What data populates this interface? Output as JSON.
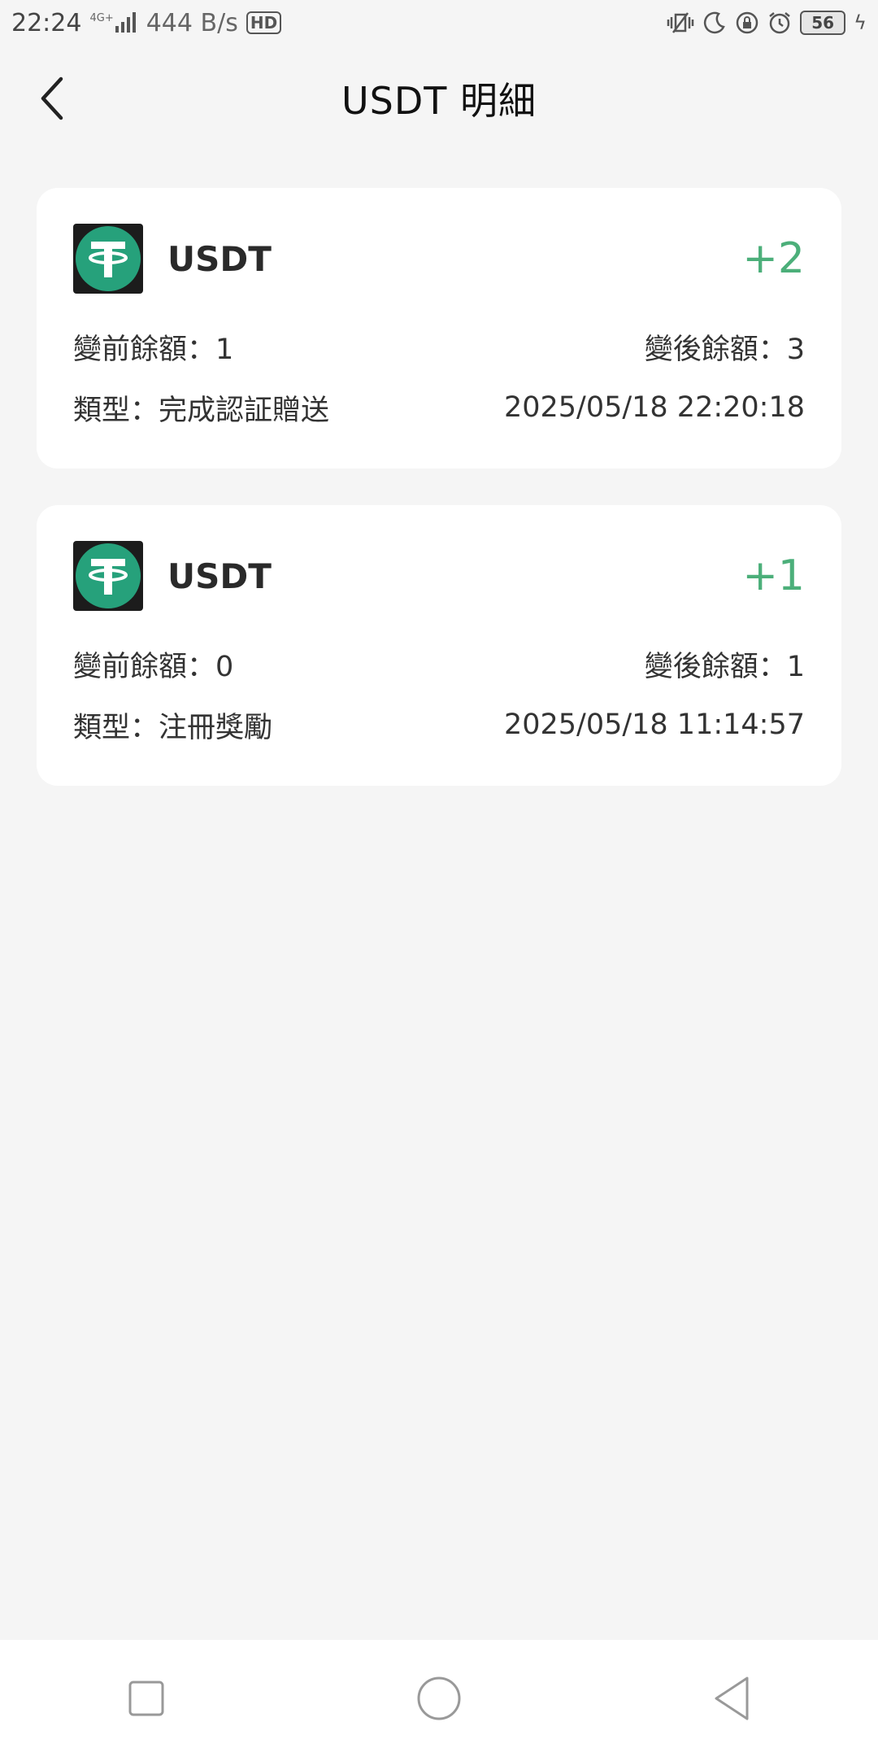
{
  "status_bar": {
    "time": "22:24",
    "network": "4G+",
    "speed": "444 B/s",
    "hd": "HD",
    "battery": "56"
  },
  "header": {
    "title": "USDT 明細"
  },
  "records": [
    {
      "coin": "USDT",
      "amount": "+2",
      "before_label": "變前餘額：",
      "before_value": "1",
      "after_label": "變後餘額：",
      "after_value": "3",
      "type_label": "類型：",
      "type_value": "完成認証贈送",
      "datetime": "2025/05/18 22:20:18"
    },
    {
      "coin": "USDT",
      "amount": "+1",
      "before_label": "變前餘額：",
      "before_value": "0",
      "after_label": "變後餘額：",
      "after_value": "1",
      "type_label": "類型：",
      "type_value": "注冊獎勵",
      "datetime": "2025/05/18 11:14:57"
    }
  ],
  "colors": {
    "amount_green": "#4caf7a",
    "tether_teal": "#26a17b",
    "background": "#f5f5f5"
  },
  "icons": {
    "back": "chevron-left-icon",
    "coin": "tether-icon",
    "nav_recent": "square-icon",
    "nav_home": "circle-icon",
    "nav_back": "triangle-back-icon"
  }
}
